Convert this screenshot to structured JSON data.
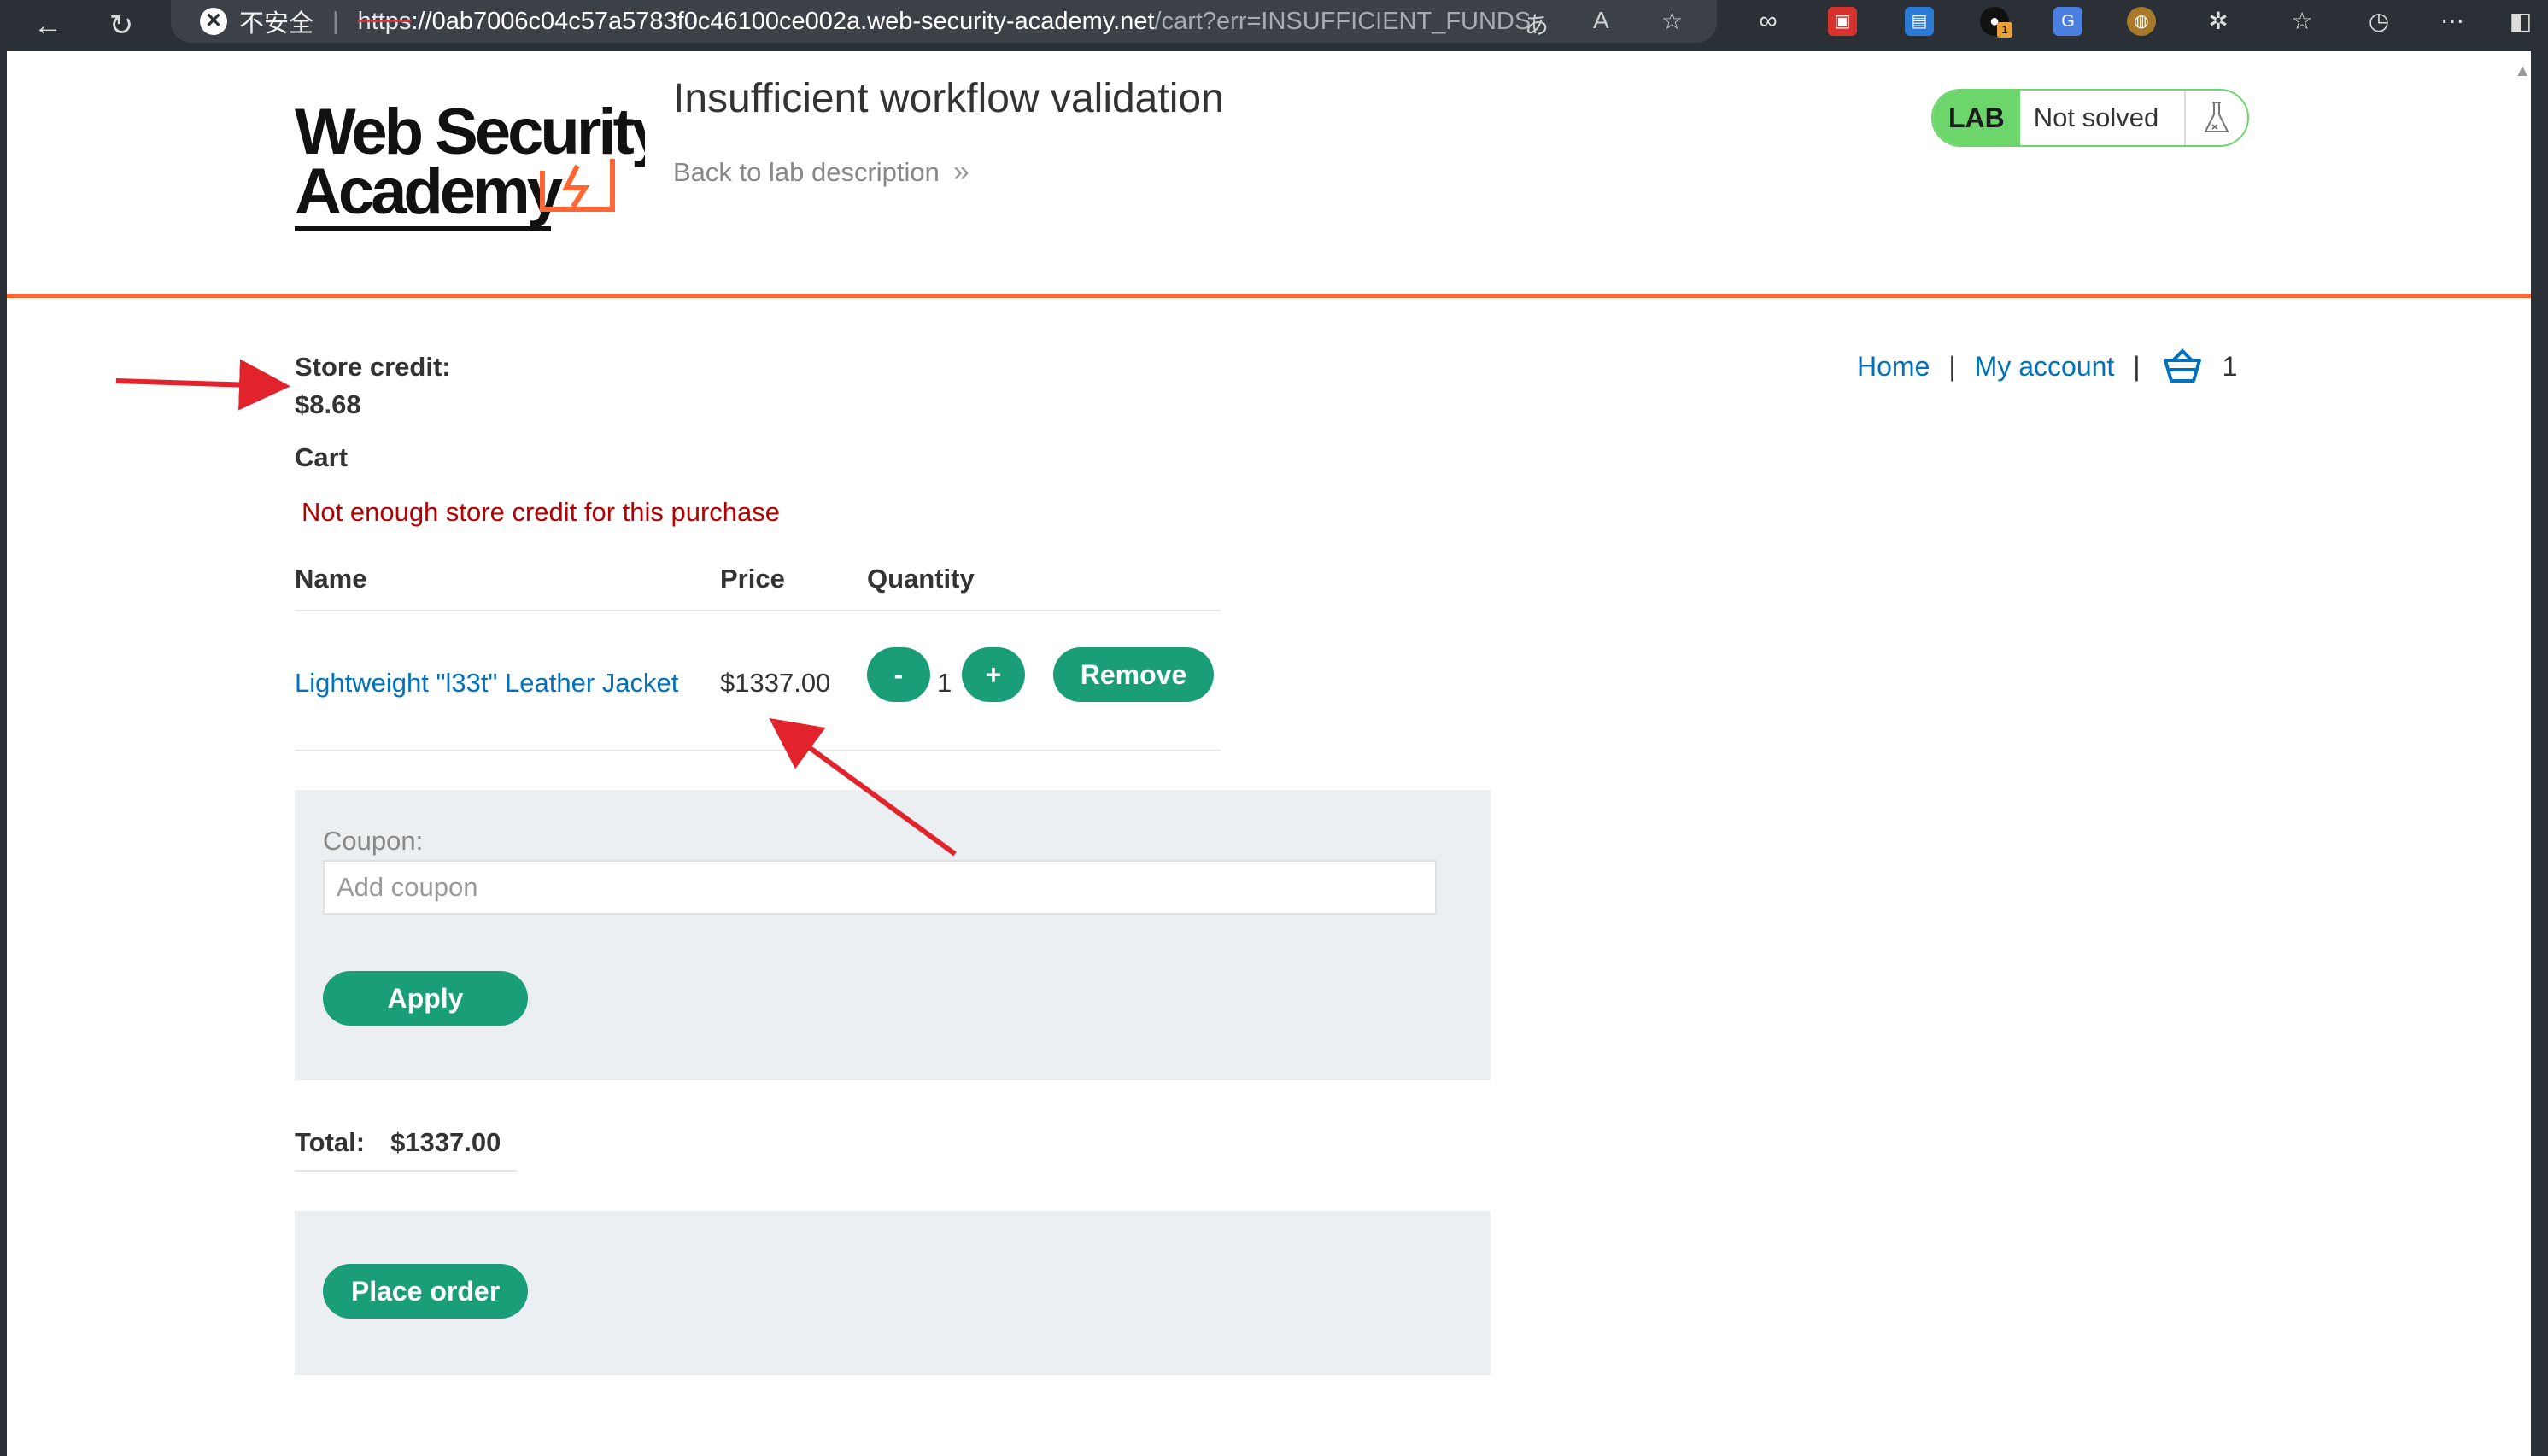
{
  "browser": {
    "insecure_label": "不安全",
    "url_scheme": "https",
    "url_host": "://0ab7006c04c57a5783f0c46100ce002a.web-security-academy.net",
    "url_path": "/cart?err=INSUFFICIENT_FUNDS",
    "extension_badge": "1"
  },
  "header": {
    "logo_line1": "Web Security",
    "logo_line2": "Academy",
    "lab_title": "Insufficient workflow validation",
    "back_link": "Back to lab description",
    "lab_badge": "LAB",
    "lab_status": "Not solved"
  },
  "nav": {
    "home": "Home",
    "separator": "|",
    "my_account": "My account",
    "cart_count": "1"
  },
  "store_credit": {
    "label": "Store credit:",
    "value": "$8.68"
  },
  "cart": {
    "heading": "Cart",
    "error": "Not enough store credit for this purchase",
    "columns": [
      "Name",
      "Price",
      "Quantity"
    ],
    "items": [
      {
        "name": "Lightweight \"l33t\" Leather Jacket",
        "price": "$1337.00",
        "quantity": "1",
        "decrease_label": "-",
        "increase_label": "+",
        "remove_label": "Remove"
      }
    ]
  },
  "coupon": {
    "label": "Coupon:",
    "placeholder": "Add coupon",
    "apply_label": "Apply"
  },
  "total": {
    "label": "Total:",
    "value": "$1337.00"
  },
  "order": {
    "place_order_label": "Place order"
  },
  "colors": {
    "accent_green": "#1a9e78",
    "brand_orange": "#ff6633",
    "link_blue": "#0071bc",
    "error_red": "#b50000",
    "annotation_red": "#e3232c",
    "lab_green": "#6cd56c"
  }
}
